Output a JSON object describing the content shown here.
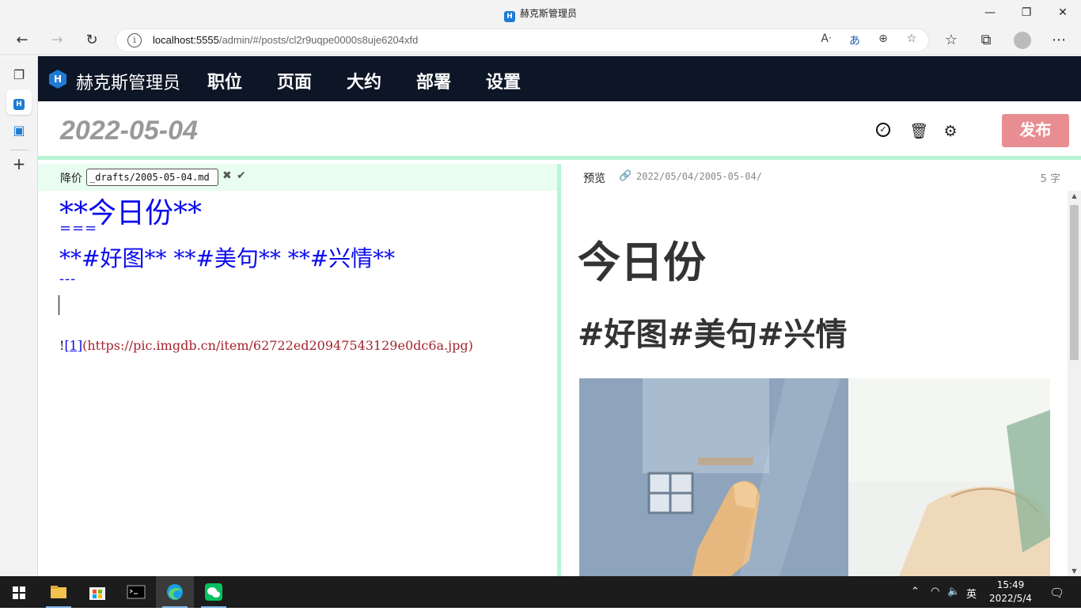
{
  "browser": {
    "window_title": "赫克斯管理员",
    "url_host": "localhost:5555",
    "url_path": "/admin/#/posts/cl2r9uqpe0000s8uje6204xfd"
  },
  "app": {
    "brand": "赫克斯管理员",
    "logo_letter": "H",
    "nav": [
      "职位",
      "页面",
      "大约",
      "部署",
      "设置"
    ]
  },
  "post": {
    "title": "2022-05-04",
    "publish_label": "发布"
  },
  "editor": {
    "label": "降价",
    "path_value": "_drafts/2005-05-04.md",
    "lines": {
      "h1": "**今日份**",
      "u1": "===",
      "h2": "**#好图** **#美句** **#兴情**",
      "u2": "---",
      "img_prefix": "!",
      "img_ref": "[1]",
      "img_link": "(https://pic.imgdb.cn/item/62722ed20947543129e0dc6a.jpg)"
    }
  },
  "preview": {
    "label": "预览",
    "permalink": "2022/05/04/2005-05-04/",
    "word_count": "5 字",
    "h1": "今日份",
    "h2": "#好图#美句#兴情"
  },
  "taskbar": {
    "ime": "英",
    "time": "15:49",
    "date": "2022/5/4"
  },
  "colors": {
    "nav_bg": "#0d1626",
    "accent_green": "#b8f5d5",
    "publish_bg": "#e88e92",
    "md_blue": "#0a0aee",
    "md_link_red": "#a4242c"
  }
}
